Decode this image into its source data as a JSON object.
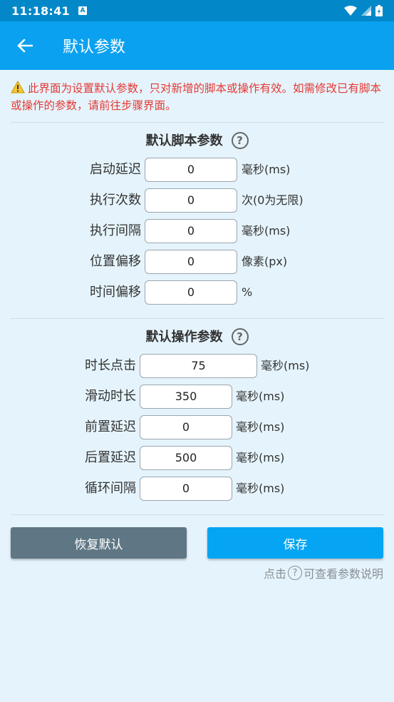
{
  "status_bar": {
    "time": "11:18:41",
    "notif_icon": "A"
  },
  "app_bar": {
    "title": "默认参数"
  },
  "warning": {
    "text": "此界面为设置默认参数，只对新增的脚本或操作有效。如需修改已有脚本或操作的参数，请前往步骤界面。"
  },
  "script_section": {
    "title": "默认脚本参数",
    "help": "?",
    "rows": [
      {
        "label": "启动延迟",
        "value": "0",
        "unit": "毫秒(ms)"
      },
      {
        "label": "执行次数",
        "value": "0",
        "unit": "次(0为无限)"
      },
      {
        "label": "执行间隔",
        "value": "0",
        "unit": "毫秒(ms)"
      },
      {
        "label": "位置偏移",
        "value": "0",
        "unit": "像素(px)"
      },
      {
        "label": "时间偏移",
        "value": "0",
        "unit": "%"
      }
    ]
  },
  "action_section": {
    "title": "默认操作参数",
    "help": "?",
    "rows": [
      {
        "label": "时长点击",
        "value": "75",
        "unit": "毫秒(ms)"
      },
      {
        "label": "滑动时长",
        "value": "350",
        "unit": "毫秒(ms)"
      },
      {
        "label": "前置延迟",
        "value": "0",
        "unit": "毫秒(ms)"
      },
      {
        "label": "后置延迟",
        "value": "500",
        "unit": "毫秒(ms)"
      },
      {
        "label": "循环间隔",
        "value": "0",
        "unit": "毫秒(ms)"
      }
    ]
  },
  "buttons": {
    "reset": "恢复默认",
    "save": "保存"
  },
  "hint": {
    "before": "点击",
    "help": "?",
    "after": "可查看参数说明"
  },
  "colors": {
    "status_bar": "#0288c8",
    "app_bar": "#0aa1f0",
    "background": "#e5f4fc",
    "warning": "#e53935",
    "reset_button": "#5f7784",
    "save_button": "#06a5f4"
  }
}
